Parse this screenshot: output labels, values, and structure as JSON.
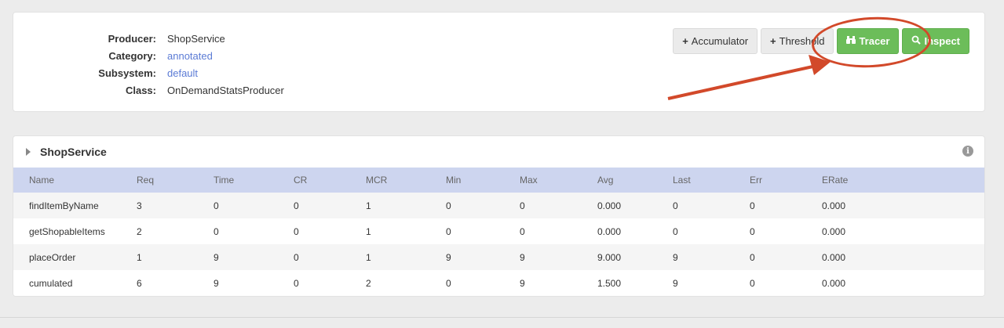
{
  "producer": {
    "rows": [
      {
        "label": "Producer:",
        "value": "ShopService",
        "link": false
      },
      {
        "label": "Category:",
        "value": "annotated",
        "link": true
      },
      {
        "label": "Subsystem:",
        "value": "default",
        "link": true
      },
      {
        "label": "Class:",
        "value": "OnDemandStatsProducer",
        "link": false
      }
    ]
  },
  "buttons": {
    "accumulator": {
      "icon": "+",
      "label": "Accumulator"
    },
    "threshold": {
      "icon": "+",
      "label": "Threshold"
    },
    "tracer": {
      "icon": "binoculars-icon",
      "label": "Tracer"
    },
    "inspect": {
      "icon": "search-icon",
      "label": "Inspect"
    }
  },
  "annotation": {
    "color": "#d2492a"
  },
  "table": {
    "title": "ShopService",
    "columns": [
      "Name",
      "Req",
      "Time",
      "CR",
      "MCR",
      "Min",
      "Max",
      "Avg",
      "Last",
      "Err",
      "ERate"
    ],
    "rows": [
      [
        "findItemByName",
        "3",
        "0",
        "0",
        "1",
        "0",
        "0",
        "0.000",
        "0",
        "0",
        "0.000"
      ],
      [
        "getShopableItems",
        "2",
        "0",
        "0",
        "1",
        "0",
        "0",
        "0.000",
        "0",
        "0",
        "0.000"
      ],
      [
        "placeOrder",
        "1",
        "9",
        "0",
        "1",
        "9",
        "9",
        "9.000",
        "9",
        "0",
        "0.000"
      ],
      [
        "cumulated",
        "6",
        "9",
        "0",
        "2",
        "0",
        "9",
        "1.500",
        "9",
        "0",
        "0.000"
      ]
    ]
  },
  "colors": {
    "accent_green": "#6cbd5a",
    "header_blue": "#cdd5ef",
    "link": "#5b7bd5"
  }
}
